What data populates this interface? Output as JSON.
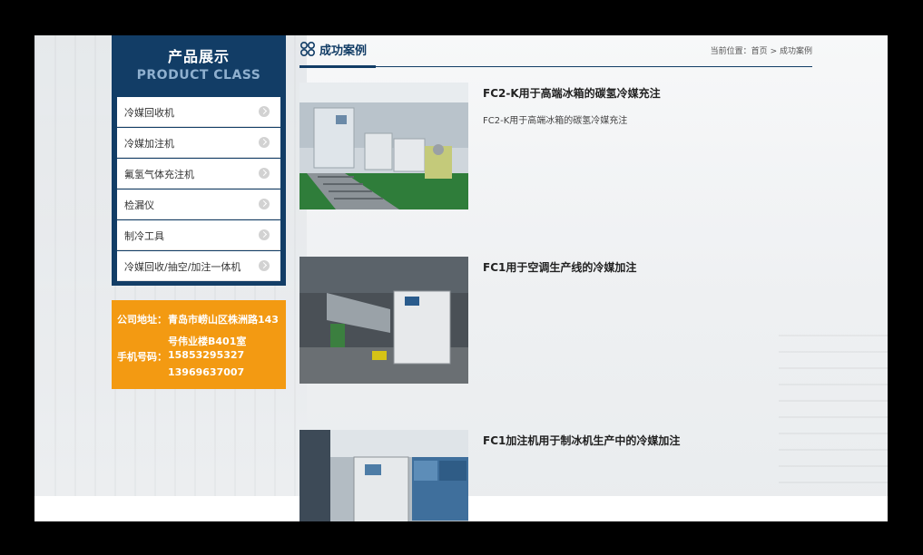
{
  "sidebar": {
    "title_cn": "产品展示",
    "title_en": "PRODUCT CLASS",
    "items": [
      {
        "label": "冷媒回收机"
      },
      {
        "label": "冷媒加注机"
      },
      {
        "label": "氟氢气体充注机"
      },
      {
        "label": "检漏仪"
      },
      {
        "label": "制冷工具"
      },
      {
        "label": "冷媒回收/抽空/加注一体机"
      }
    ]
  },
  "contact": {
    "address_label": "公司地址：",
    "address_line1": "青岛市崂山区株洲路143",
    "address_line2": "号伟业楼B401室",
    "phone_label": "手机号码：",
    "phone1": "15853295327",
    "phone2": "13969637007"
  },
  "main": {
    "title": "成功案例",
    "breadcrumb": {
      "prefix": "当前位置：",
      "home": "首页",
      "sep": ">",
      "current": "成功案例"
    },
    "cases": [
      {
        "title": "FC2-K用于高端冰箱的碳氢冷媒充注",
        "desc": "FC2-K用于高端冰箱的碳氢冷媒充注"
      },
      {
        "title": "FC1用于空调生产线的冷媒加注",
        "desc": ""
      },
      {
        "title": "FC1加注机用于制冰机生产中的冷媒加注",
        "desc": ""
      }
    ]
  },
  "colors": {
    "brand_navy": "#123d66",
    "accent_orange": "#f39a12"
  }
}
